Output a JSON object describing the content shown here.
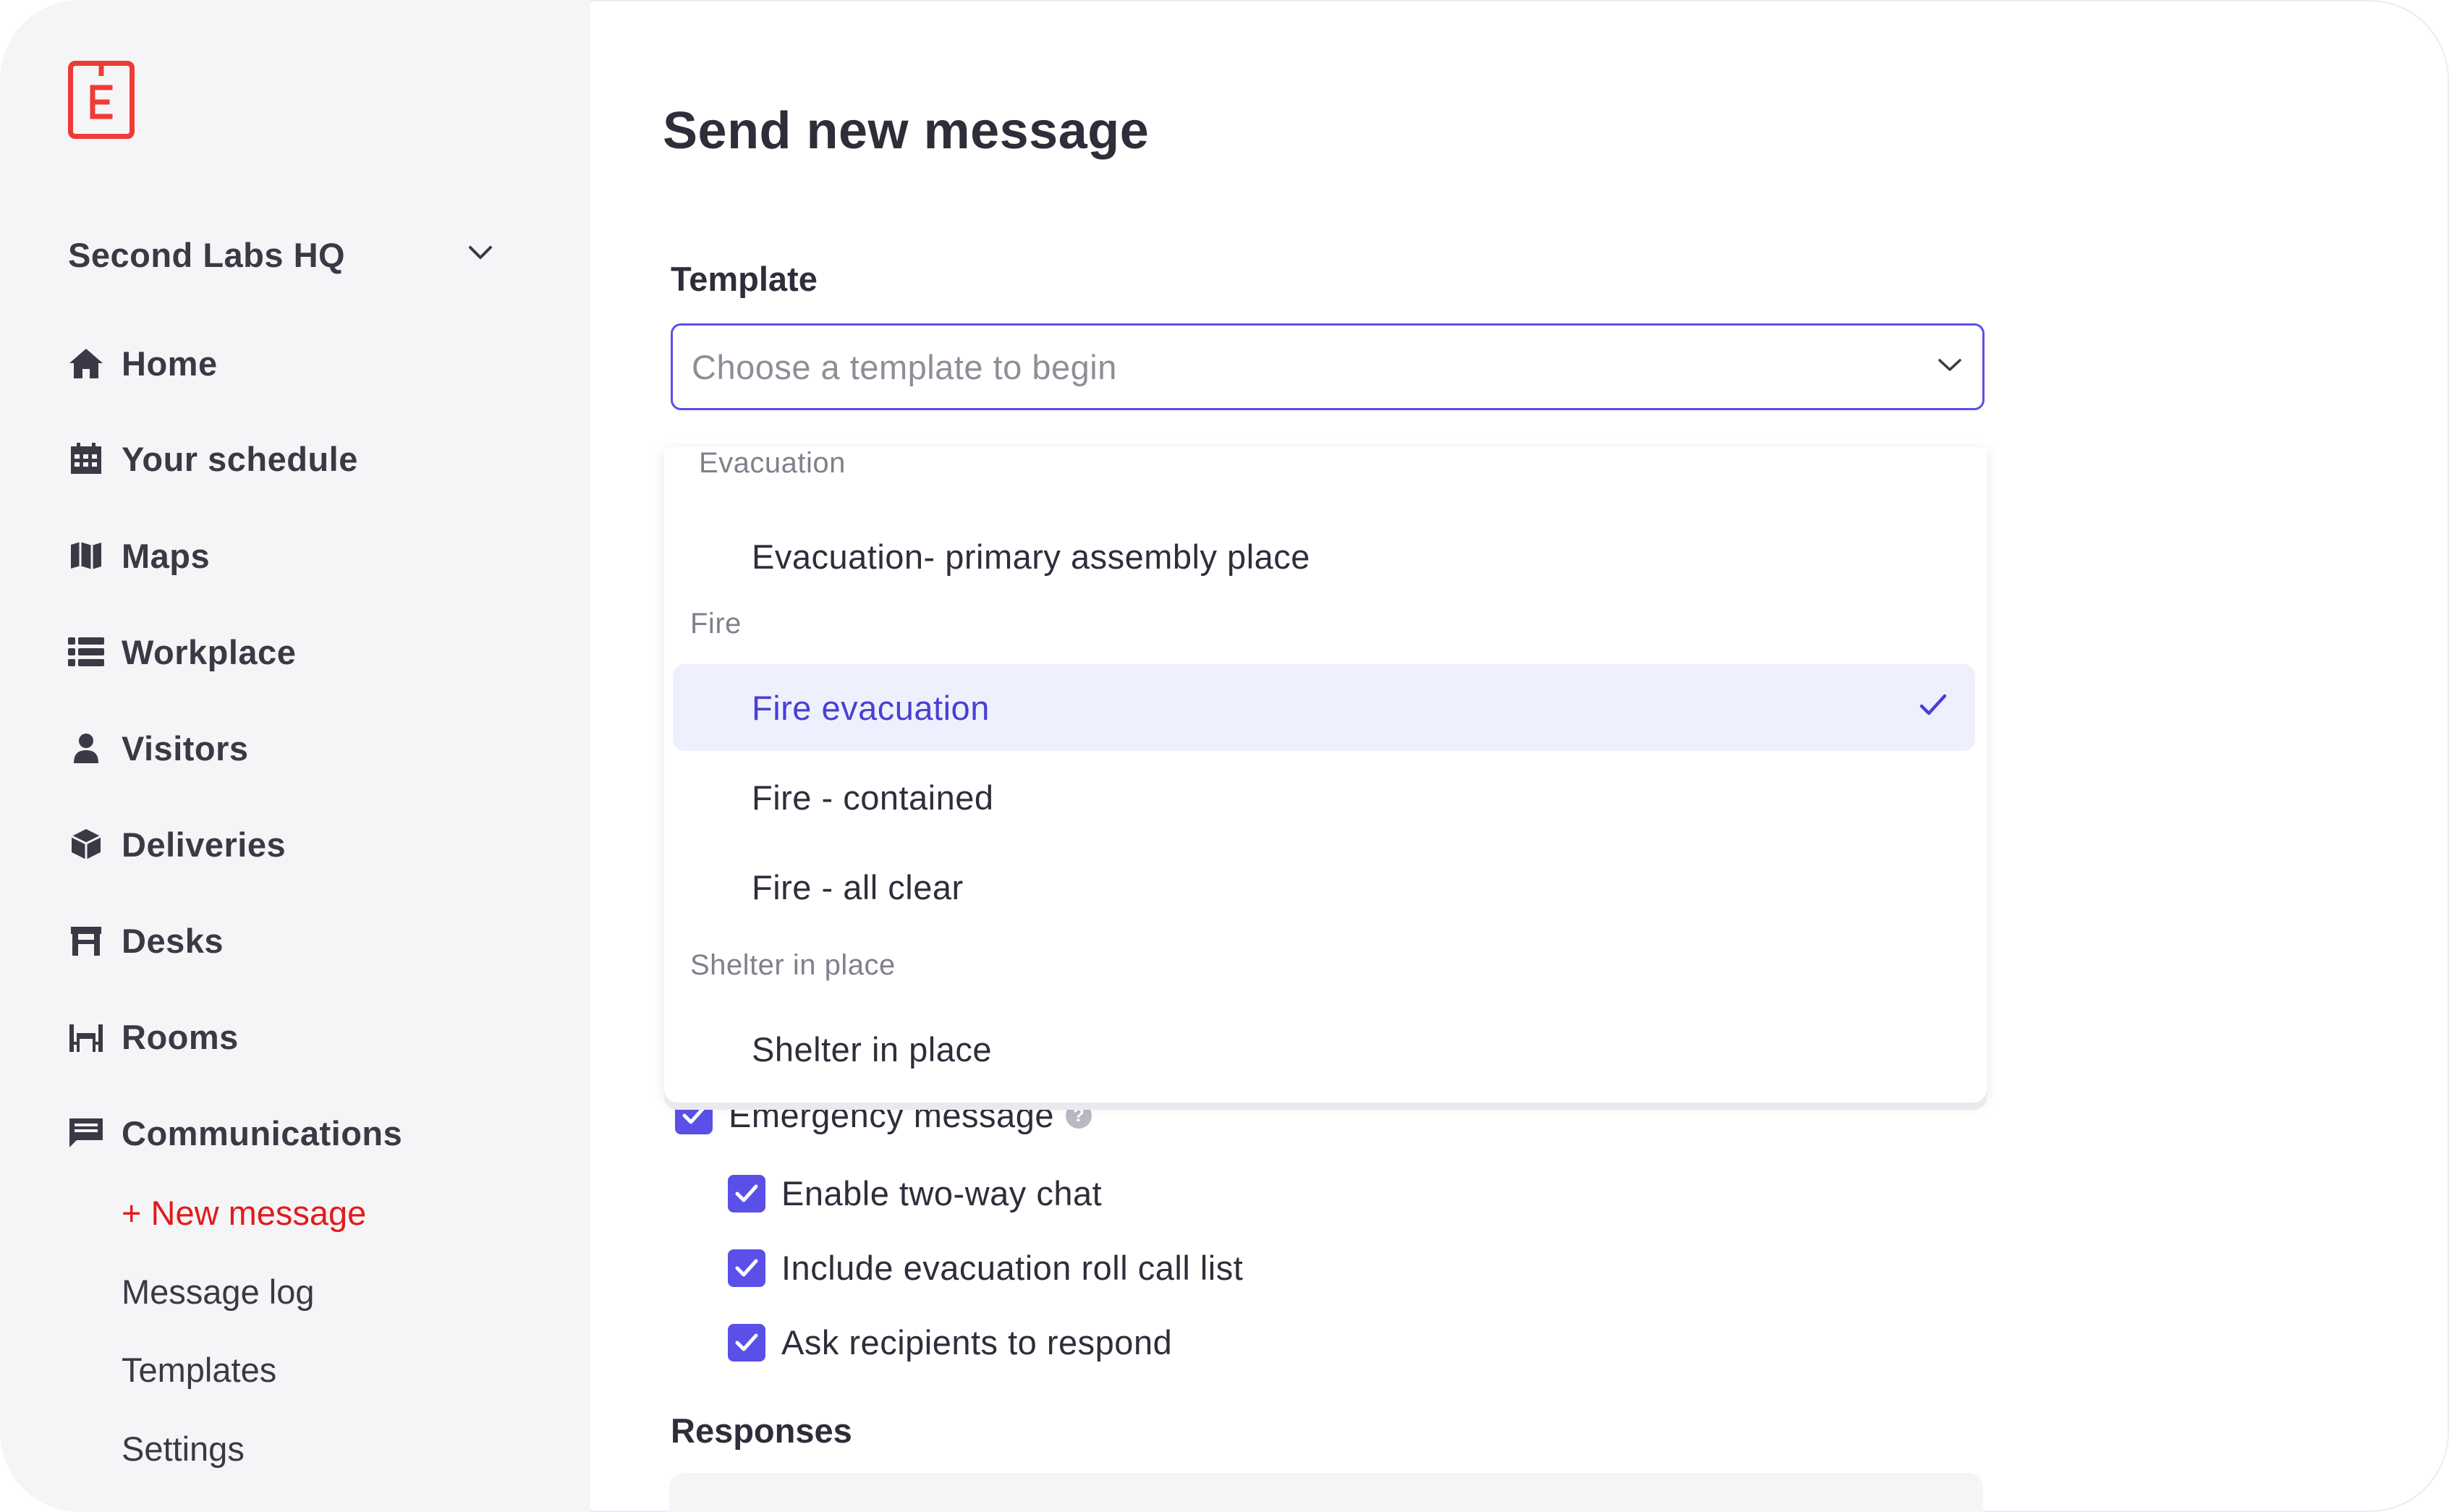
{
  "app": {
    "brand_letter": "E"
  },
  "sidebar": {
    "org_name": "Second Labs HQ",
    "nav": [
      {
        "label": "Home",
        "icon": "home-icon"
      },
      {
        "label": "Your schedule",
        "icon": "calendar-icon"
      },
      {
        "label": "Maps",
        "icon": "map-icon"
      },
      {
        "label": "Workplace",
        "icon": "list-icon"
      },
      {
        "label": "Visitors",
        "icon": "visitor-icon"
      },
      {
        "label": "Deliveries",
        "icon": "box-icon"
      },
      {
        "label": "Desks",
        "icon": "desk-icon"
      },
      {
        "label": "Rooms",
        "icon": "room-icon"
      },
      {
        "label": "Communications",
        "icon": "message-icon"
      }
    ],
    "sub_nav": [
      {
        "label": "+ New message",
        "active": true
      },
      {
        "label": "Message log"
      },
      {
        "label": "Templates"
      },
      {
        "label": "Settings"
      }
    ]
  },
  "main": {
    "title": "Send new message",
    "template_label": "Template",
    "template_placeholder": "Choose a template to begin",
    "dropdown": {
      "groups": [
        {
          "label": "Evacuation",
          "options": [
            {
              "label": "Evacuation- primary assembly place"
            }
          ]
        },
        {
          "label": "Fire",
          "options": [
            {
              "label": "Fire evacuation",
              "selected": true
            },
            {
              "label": "Fire - contained"
            },
            {
              "label": "Fire - all clear"
            }
          ]
        },
        {
          "label": "Shelter in place",
          "options": [
            {
              "label": "Shelter in place"
            }
          ]
        }
      ]
    },
    "checkboxes": {
      "emergency": "Emergency message",
      "two_way_chat": "Enable two-way chat",
      "roll_call": "Include evacuation roll call list",
      "ask_respond": "Ask recipients to respond"
    },
    "help_glyph": "?",
    "responses_label": "Responses"
  },
  "colors": {
    "accent": "#5a50e8",
    "brand_red": "#ef3b36",
    "active_link": "#e21b1b",
    "sidebar_bg": "#f5f5f7",
    "selected_bg": "#eef1fd"
  }
}
